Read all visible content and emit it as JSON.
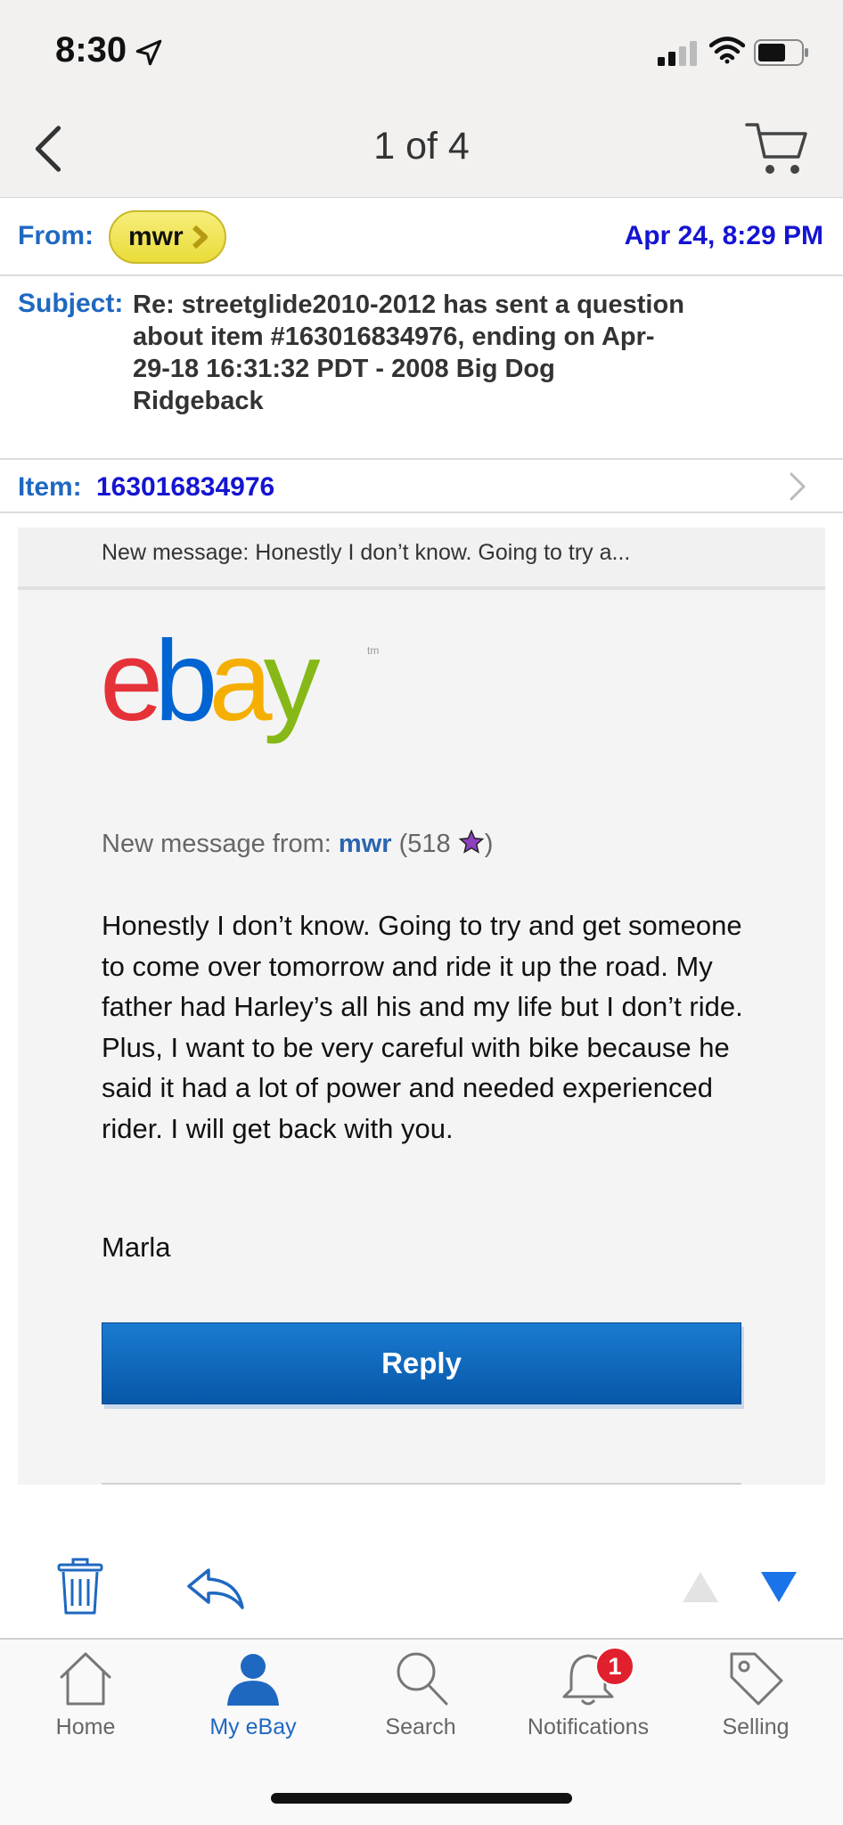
{
  "status": {
    "time": "8:30"
  },
  "nav": {
    "pager": "1 of 4"
  },
  "header": {
    "from_label": "From:",
    "from_name": "mwr",
    "date": "Apr 24, 8:29 PM",
    "subject_label": "Subject:",
    "subject": "Re: streetglide2010-2012 has sent a question about item #163016834976, ending on Apr-29-18 16:31:32 PDT - 2008 Big Dog Ridgeback",
    "item_label": "Item:",
    "item_number": "163016834976"
  },
  "message": {
    "preview": "New message: Honestly I don’t know. Going to try a...",
    "from_prefix": "New message from: ",
    "sender": "mwr",
    "feedback_open": " (518 ",
    "feedback_close": ")",
    "body": "Honestly I don’t know. Going to try and get someone to come over tomorrow and ride it up the road. My father had Harley’s all his and my life but I don’t ride. Plus, I want to be very careful with bike because he said it had a lot of power and needed experienced rider. I will get back with you.",
    "signature": "Marla",
    "reply_label": "Reply"
  },
  "tabs": [
    {
      "label": "Home",
      "icon": "home-icon"
    },
    {
      "label": "My eBay",
      "icon": "person-icon"
    },
    {
      "label": "Search",
      "icon": "search-icon"
    },
    {
      "label": "Notifications",
      "icon": "bell-icon",
      "badge": "1"
    },
    {
      "label": "Selling",
      "icon": "tag-icon"
    }
  ],
  "colors": {
    "link_blue": "#1f68c1",
    "date_blue": "#1414d2",
    "reply_button": "#0a64b8",
    "badge_red": "#e0202d"
  }
}
